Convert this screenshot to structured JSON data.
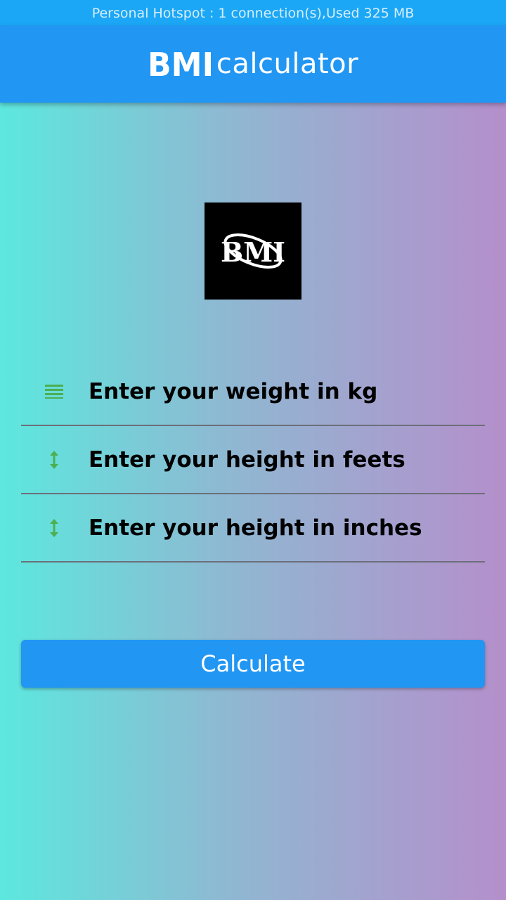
{
  "status_bar": {
    "text": "Personal Hotspot : 1 connection(s),Used  325 MB"
  },
  "app_bar": {
    "logo_text": "BMI",
    "title": "calculator"
  },
  "center_logo": {
    "text": "BMI"
  },
  "form": {
    "fields": [
      {
        "icon": "weight-bars-icon",
        "placeholder": "Enter your weight in kg",
        "value": ""
      },
      {
        "icon": "vertical-arrows-icon",
        "placeholder": "Enter your height in feets",
        "value": ""
      },
      {
        "icon": "vertical-arrows-icon",
        "placeholder": "Enter your height in inches",
        "value": ""
      }
    ],
    "submit_label": "Calculate"
  },
  "colors": {
    "status_bar": "#1ba7f5",
    "app_bar": "#2196f3",
    "button": "#2196f3",
    "icon": "#4caf50",
    "gradient_left": "#5ce8de",
    "gradient_right": "#b58fcb"
  }
}
